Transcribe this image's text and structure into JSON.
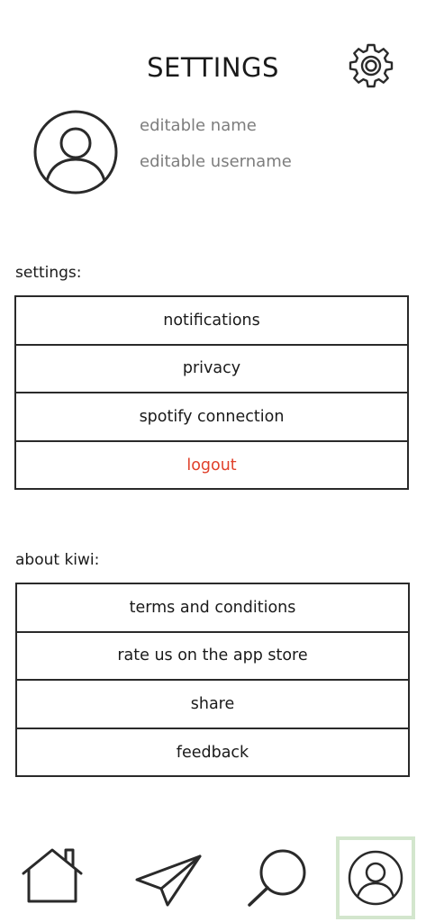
{
  "header": {
    "title": "SETTINGS",
    "settings_icon": "gear-icon"
  },
  "profile": {
    "avatar_icon": "user-avatar-icon",
    "name": "editable name",
    "username": "editable username"
  },
  "settings_section": {
    "label": "settings:",
    "items": [
      {
        "label": "notifications"
      },
      {
        "label": "privacy"
      },
      {
        "label": "spotify connection"
      },
      {
        "label": "logout",
        "color": "#e0402a"
      }
    ]
  },
  "about_section": {
    "label": "about kiwi:",
    "items": [
      {
        "label": "terms and conditions"
      },
      {
        "label": "rate us on the app store"
      },
      {
        "label": "share"
      },
      {
        "label": "feedback"
      }
    ]
  },
  "tab_bar": {
    "tabs": [
      {
        "icon": "home-icon"
      },
      {
        "icon": "send-icon"
      },
      {
        "icon": "search-icon"
      },
      {
        "icon": "profile-icon",
        "active": true
      }
    ],
    "active_highlight_color": "#d3e6cd"
  },
  "colors": {
    "text": "#1a1a1a",
    "secondary_text": "#7d7d7d",
    "danger": "#e0402a",
    "border": "#2a2a2a"
  }
}
